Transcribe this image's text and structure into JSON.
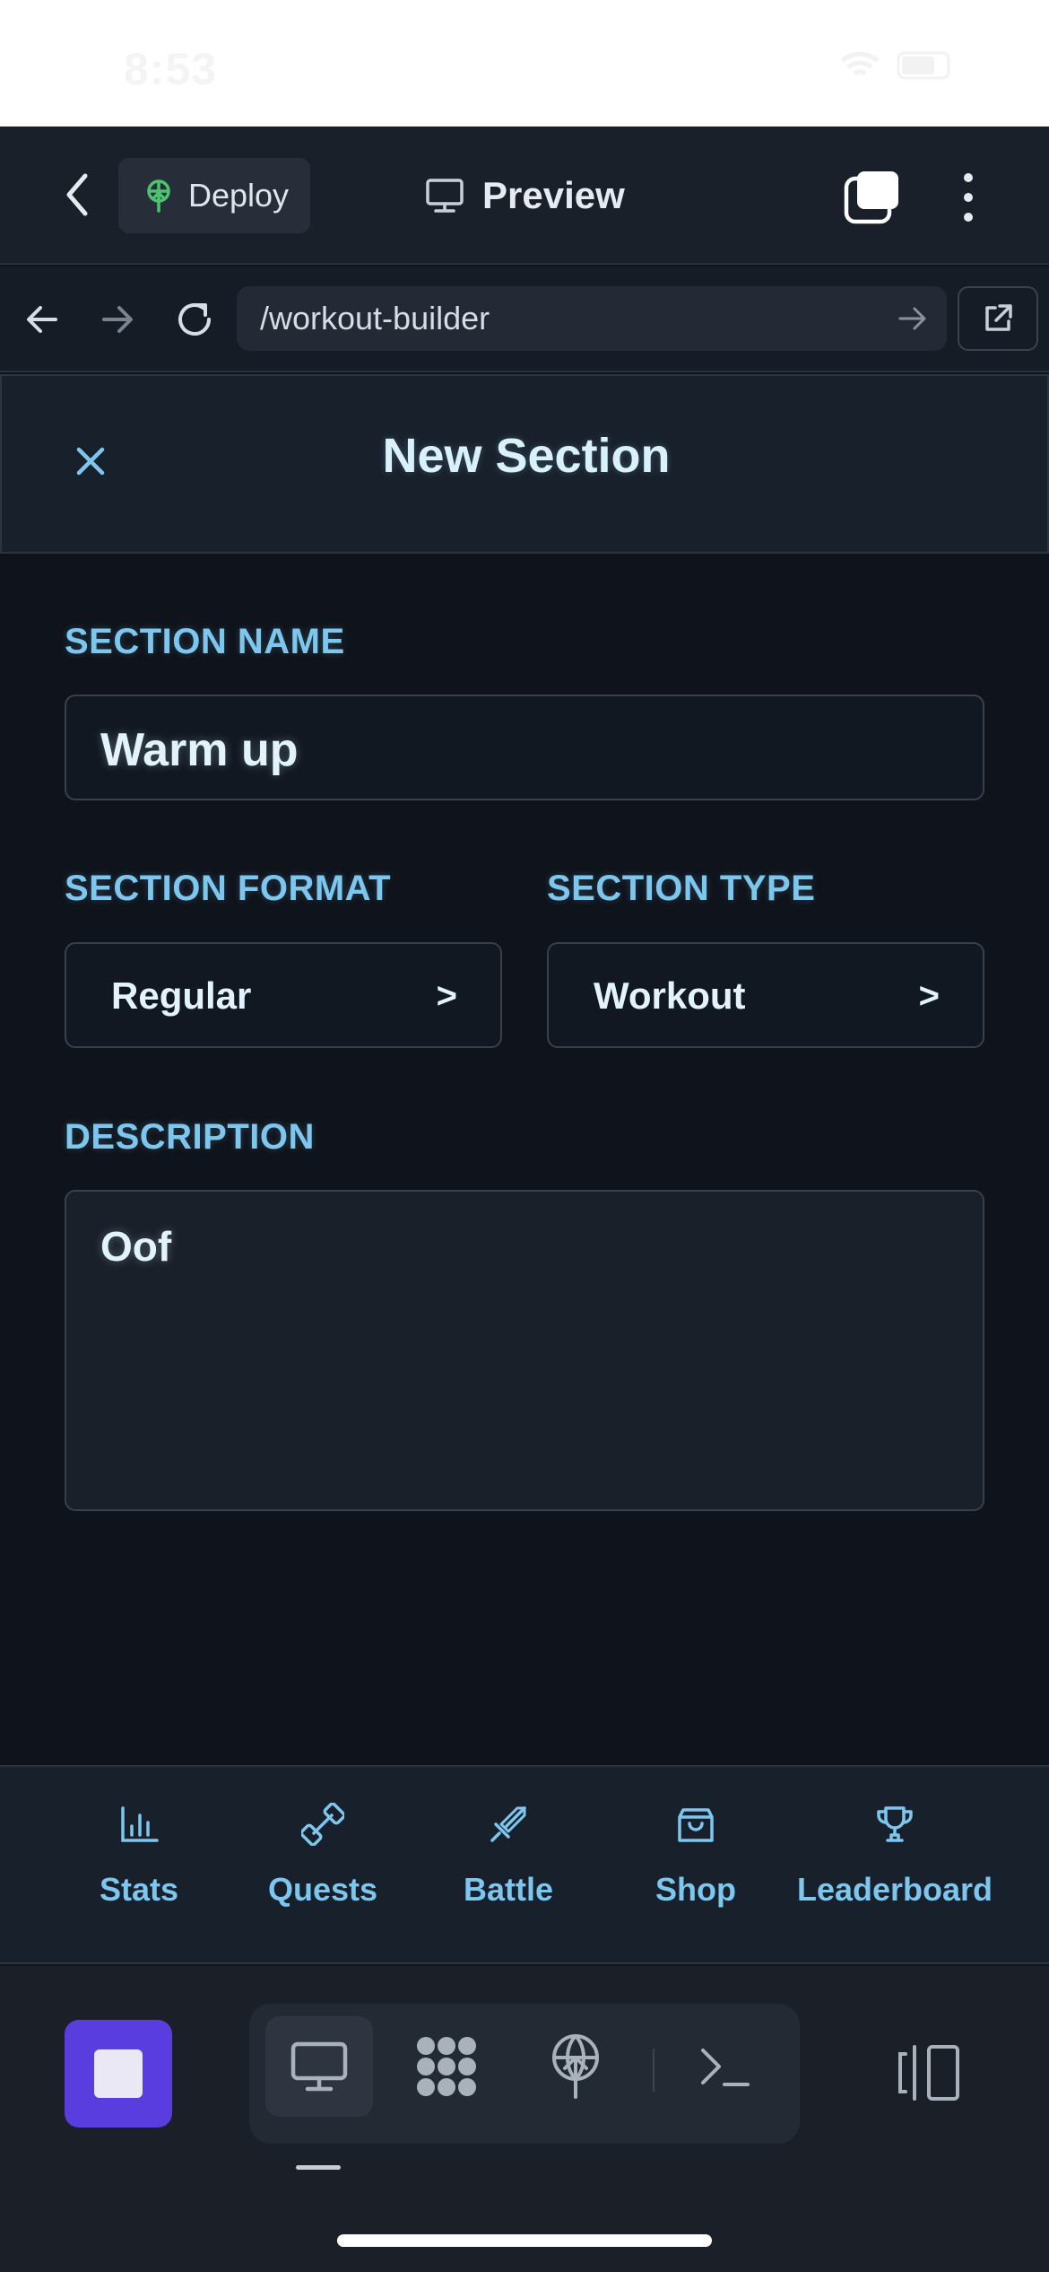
{
  "status_bar": {
    "time": "8:53"
  },
  "header": {
    "deploy_label": "Deploy",
    "preview_label": "Preview"
  },
  "browser": {
    "url": "/workout-builder"
  },
  "modal": {
    "title": "New Section"
  },
  "form": {
    "section_name_label": "SECTION NAME",
    "section_name_value": "Warm up",
    "section_format_label": "SECTION FORMAT",
    "section_format_value": "Regular",
    "section_type_label": "SECTION TYPE",
    "section_type_value": "Workout",
    "chevron": ">",
    "description_label": "DESCRIPTION",
    "description_value": "Oof"
  },
  "bottom_nav": {
    "items": [
      {
        "label": "Stats",
        "icon": "bar-chart-icon"
      },
      {
        "label": "Quests",
        "icon": "dumbbell-icon"
      },
      {
        "label": "Battle",
        "icon": "sword-icon"
      },
      {
        "label": "Shop",
        "icon": "shopping-bag-icon"
      },
      {
        "label": "Leaderboard",
        "icon": "trophy-icon"
      }
    ]
  },
  "dock": {
    "items": [
      "desktop-icon",
      "apps-icon",
      "deploy-icon",
      "terminal-icon"
    ]
  },
  "colors": {
    "accent": "#7dc6ee",
    "background": "#0f131b",
    "stop_button": "#5a3ddf"
  }
}
